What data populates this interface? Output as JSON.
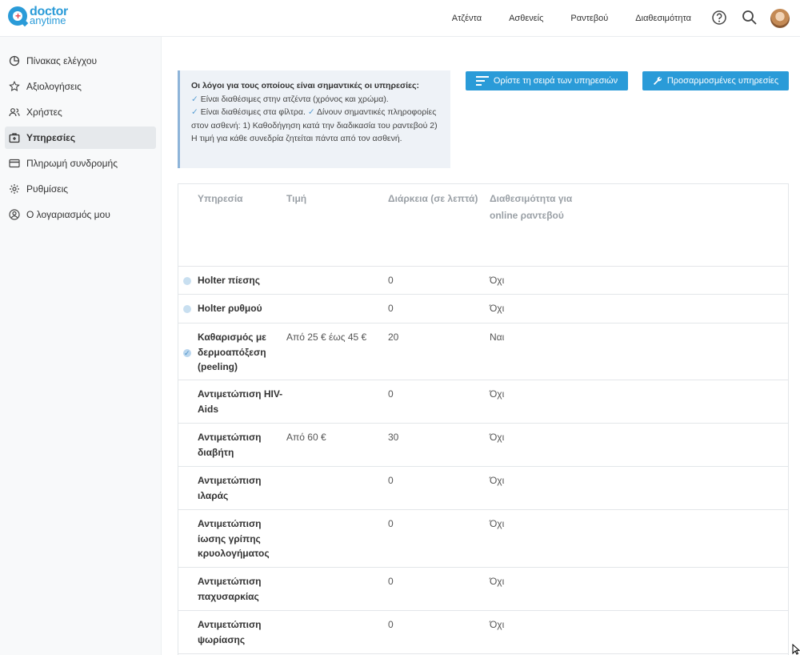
{
  "logo": {
    "line1": "doctor",
    "line2": "anytime",
    "plus": "+"
  },
  "header": {
    "nav": [
      "Ατζέντα",
      "Ασθενείς",
      "Ραντεβού",
      "Διαθεσιμότητα"
    ]
  },
  "sidebar": {
    "items": [
      {
        "label": "Πίνακας ελέγχου",
        "icon": "dashboard-icon"
      },
      {
        "label": "Αξιολογήσεις",
        "icon": "star-icon"
      },
      {
        "label": "Χρήστες",
        "icon": "users-icon"
      },
      {
        "label": "Υπηρεσίες",
        "icon": "services-icon",
        "active": true
      },
      {
        "label": "Πληρωμή συνδρομής",
        "icon": "credit-card-icon"
      },
      {
        "label": "Ρυθμίσεις",
        "icon": "gear-icon"
      },
      {
        "label": "Ο λογαριασμός μου",
        "icon": "account-icon"
      }
    ]
  },
  "info": {
    "title": "Οι λόγοι για τους οποίους είναι σημαντικές οι υπηρεσίες:",
    "check": "✓",
    "r1": "Είναι διαθέσιμες στην ατζέντα (χρόνος και χρώμα).",
    "r2": "Είναι διαθέσιμες στα φίλτρα.",
    "r3": "Δίνουν σημαντικές πληροφορίες στον ασθενή: 1) Καθοδήγηση κατά την διαδικασία του ραντεβού 2) Η τιμή για κάθε συνεδρία ζητείται πάντα από τον ασθενή."
  },
  "buttons": {
    "order": "Ορίστε τη σειρά των υπηρεσιών",
    "custom": "Προσαρμοσμένες υπηρεσίες"
  },
  "table": {
    "headers": {
      "service": "Υπηρεσία",
      "price": "Τιμή",
      "duration": "Διάρκεια (σε λεπτά)",
      "online": "Διαθεσιμότητα για online ραντεβού"
    },
    "rows": [
      {
        "service": "Holter πίεσης",
        "price": "",
        "duration": "0",
        "online": "Όχι"
      },
      {
        "service": "Holter ρυθμού",
        "price": "",
        "duration": "0",
        "online": "Όχι"
      },
      {
        "service": "Καθαρισμός με δερμοαπόξεση (peeling)",
        "price": "Από 25 € έως 45 €",
        "duration": "20",
        "online": "Ναι"
      },
      {
        "service": "Αντιμετώπιση HIV-Aids",
        "price": "",
        "duration": "0",
        "online": "Όχι"
      },
      {
        "service": "Αντιμετώπιση διαβήτη",
        "price": "Από 60 €",
        "duration": "30",
        "online": "Όχι"
      },
      {
        "service": "Αντιμετώπιση ιλαράς",
        "price": "",
        "duration": "0",
        "online": "Όχι"
      },
      {
        "service": "Αντιμετώπιση ίωσης γρίπης κρυολογήματος",
        "price": "",
        "duration": "0",
        "online": "Όχι"
      },
      {
        "service": "Αντιμετώπιση παχυσαρκίας",
        "price": "",
        "duration": "0",
        "online": "Όχι"
      },
      {
        "service": "Αντιμετώπιση ψωρίασης",
        "price": "",
        "duration": "0",
        "online": "Όχι"
      }
    ]
  },
  "colors": {
    "brand": "#2a9bd8",
    "sidebar_bg": "#f8f9fa",
    "info_bg": "#eef2f7"
  }
}
